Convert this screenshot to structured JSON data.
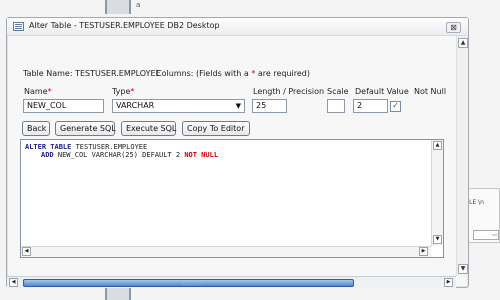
{
  "window": {
    "title": "Alter Table - TESTUSER.EMPLOYEE DB2 Desktop",
    "close_glyph": "⊠",
    "icon": "table-icon"
  },
  "background": {
    "top_text": "a",
    "behind_text": "BLE \\n",
    "behind_input_glyph": "⇨"
  },
  "form": {
    "table_name": "Table Name: TESTUSER.EMPLOYEE",
    "columns_info_prefix": "Columns: (Fields with a ",
    "columns_info_star": "*",
    "columns_info_suffix": " are required)",
    "labels": {
      "name": "Name",
      "type": "Type",
      "length_precision": "Length / Precision",
      "scale": "Scale",
      "default_value": "Default Value",
      "not_null": "Not Null"
    },
    "required_mark": "*",
    "values": {
      "name": "NEW_COL",
      "type": "VARCHAR",
      "length": "25",
      "scale": "",
      "default": "2",
      "not_null_checked": true,
      "checkbox_glyph": "✓"
    }
  },
  "buttons": {
    "back": "Back",
    "generate_sql": "Generate SQL",
    "execute_sql": "Execute SQL",
    "copy_to_editor": "Copy To Editor"
  },
  "sql": {
    "kw_alter_table": "ALTER TABLE",
    "table": "TESTUSER.EMPLOYEE",
    "kw_add": "ADD",
    "column_def": "NEW_COL VARCHAR(25) DEFAULT 2",
    "kw_not_null": "NOT NULL"
  },
  "scroll_glyphs": {
    "up": "▲",
    "down": "▼",
    "left": "◀",
    "right": "▶",
    "grip": "::::::::::"
  }
}
